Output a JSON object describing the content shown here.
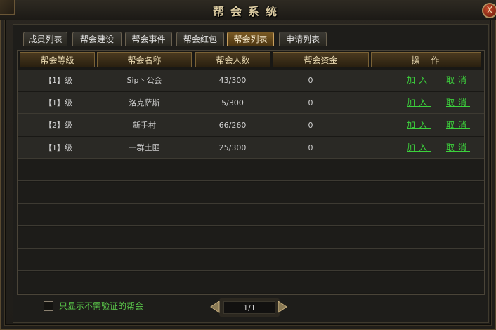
{
  "window": {
    "title": "帮会系统",
    "close_label": "X"
  },
  "tabs": [
    {
      "label": "成员列表",
      "active": false
    },
    {
      "label": "帮会建设",
      "active": false
    },
    {
      "label": "帮会事件",
      "active": false
    },
    {
      "label": "帮会红包",
      "active": false
    },
    {
      "label": "帮会列表",
      "active": true
    },
    {
      "label": "申请列表",
      "active": false
    }
  ],
  "table": {
    "headers": [
      "帮会等级",
      "帮会名称",
      "帮会人数",
      "帮会资金",
      "操　作"
    ],
    "rows": [
      {
        "level": "【1】级",
        "name": "Sip丶公会",
        "members": "43/300",
        "funds": "0",
        "join": "加入",
        "cancel": "取消"
      },
      {
        "level": "【1】级",
        "name": "洛克萨斯",
        "members": "5/300",
        "funds": "0",
        "join": "加入",
        "cancel": "取消"
      },
      {
        "level": "【2】级",
        "name": "新手村",
        "members": "66/260",
        "funds": "0",
        "join": "加入",
        "cancel": "取消"
      },
      {
        "level": "【1】级",
        "name": "一群土匪",
        "members": "25/300",
        "funds": "0",
        "join": "加入",
        "cancel": "取消"
      }
    ]
  },
  "footer": {
    "checkbox_label": "只显示不需验证的帮会",
    "checkbox_checked": false,
    "page": "1/1"
  },
  "colors": {
    "link": "#3cd13c",
    "active_tab": "#7a5a24",
    "header_text": "#e8d8b0"
  }
}
